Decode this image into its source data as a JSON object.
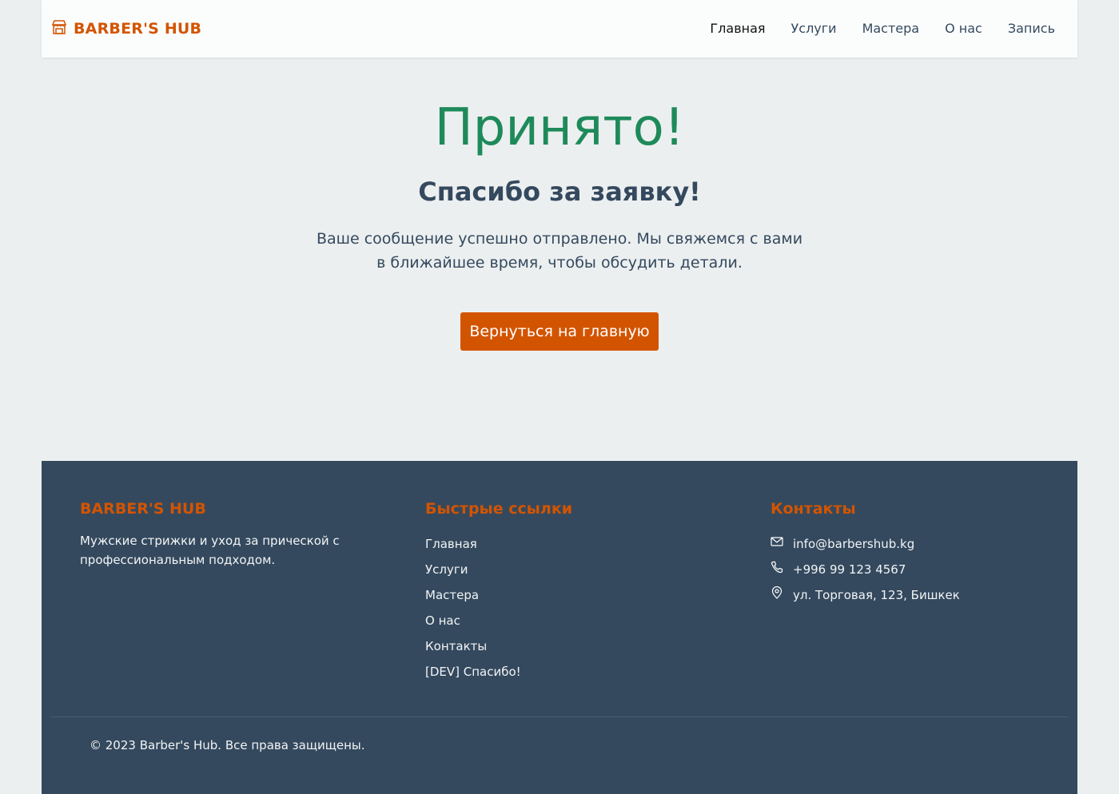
{
  "header": {
    "brand": "BARBER'S HUB",
    "nav": [
      "Главная",
      "Услуги",
      "Мастера",
      "О нас",
      "Запись"
    ]
  },
  "main": {
    "title": "Принято!",
    "subtitle": "Спасибо за заявку!",
    "message": "Ваше сообщение успешно отправлено. Мы свяжемся с вами в ближайшее время, чтобы обсудить детали.",
    "button": "Вернуться на главную"
  },
  "footer": {
    "brand": "BARBER'S HUB",
    "about": "Мужские стрижки и уход за прической с профессиональным подходом.",
    "links_title": "Быстрые ссылки",
    "links": [
      "Главная",
      "Услуги",
      "Мастера",
      "О нас",
      "Контакты",
      "[DEV] Спасибо!"
    ],
    "contacts_title": "Контакты",
    "email": "info@barbershub.kg",
    "phone": "+996 99 123 4567",
    "address": "ул. Торговая, 123, Бишкек",
    "copyright": "© 2023 Barber's Hub. Все права защищены."
  },
  "colors": {
    "accent": "#d35400",
    "success": "#1e8a5a",
    "footer_bg": "#34495e",
    "page_bg": "#eceff0"
  },
  "icons": [
    "shop-icon",
    "envelope-icon",
    "phone-icon",
    "location-pin-icon"
  ]
}
